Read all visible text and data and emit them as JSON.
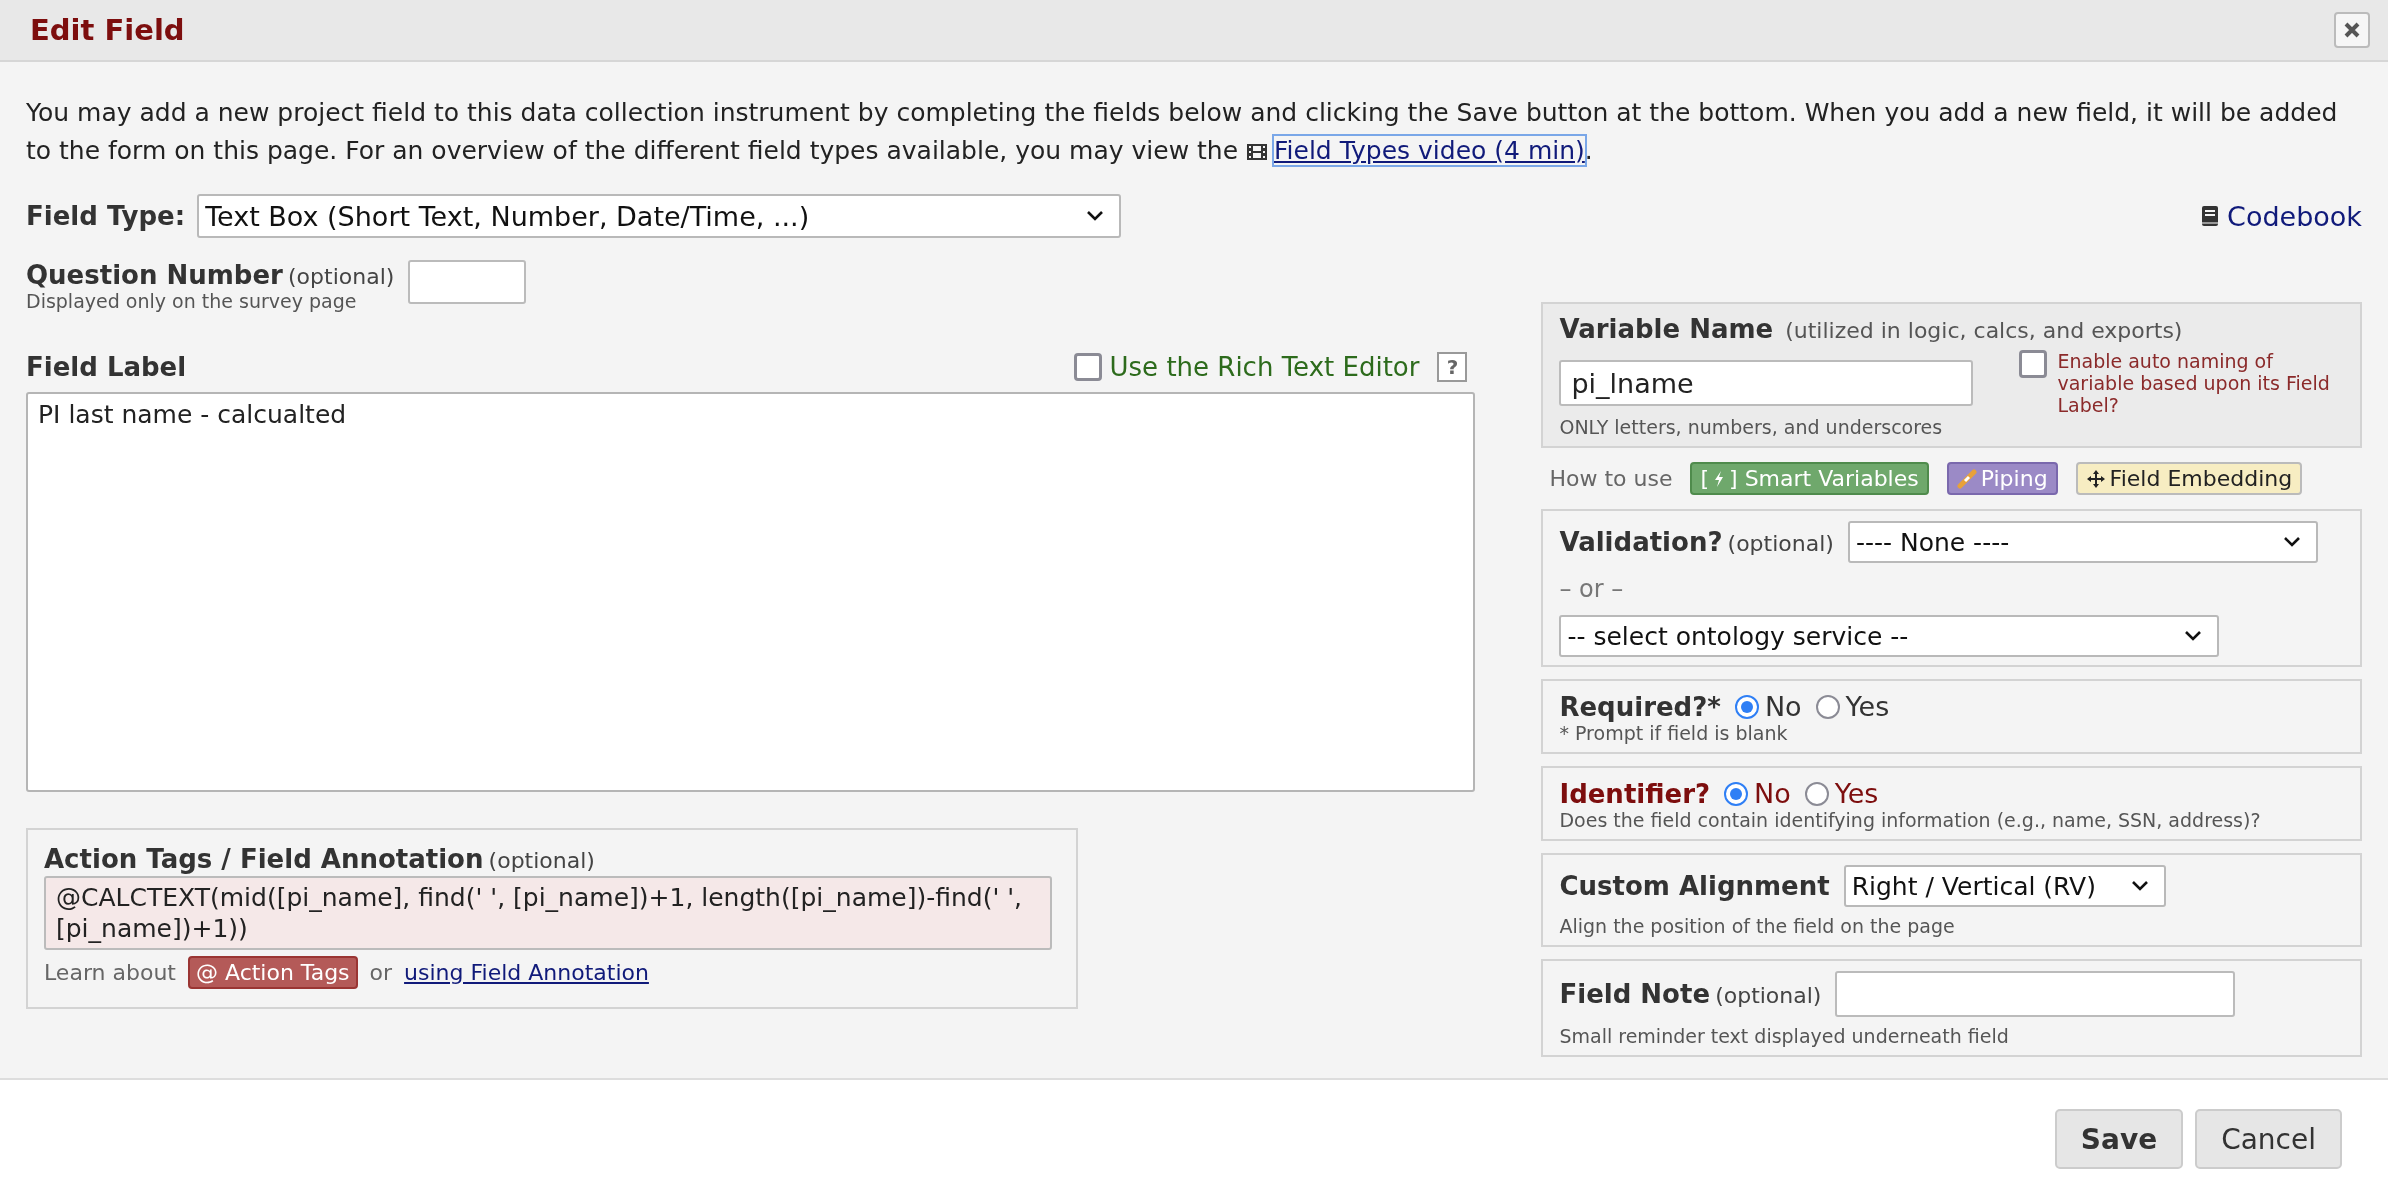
{
  "title": "Edit Field",
  "intro": {
    "text": "You may add a new project field to this data collection instrument by completing the fields below and clicking the Save button at the bottom. When you add a new field, it will be added to the form on this page. For an overview of the different field types available, you may view the",
    "link": "Field Types video (4 min)",
    "after": "."
  },
  "field_type": {
    "label": "Field Type:",
    "value": "Text Box (Short Text, Number, Date/Time, ...)"
  },
  "codebook_link": "Codebook",
  "question_number": {
    "label": "Question Number",
    "optional": "(optional)",
    "hint": "Displayed only on the survey page"
  },
  "field_label": {
    "label": "Field Label",
    "rich_text_editor": {
      "label": "Use the Rich Text Editor",
      "checked": false
    },
    "help": "?",
    "value": "PI last name - calcualted"
  },
  "action_tags": {
    "label": "Action Tags / Field Annotation",
    "optional": "(optional)",
    "value": "@CALCTEXT(mid([pi_name], find(' ', [pi_name])+1, length([pi_name])-find(' ', [pi_name])+1))",
    "learn_about": "Learn about",
    "tags_button": "@ Action Tags",
    "or": "or",
    "annotation_link": "using Field Annotation"
  },
  "variable_name": {
    "label": "Variable Name",
    "note": "(utilized in logic, calcs, and exports)",
    "value": "pi_lname",
    "hint": "ONLY letters, numbers, and underscores",
    "auto_naming": {
      "label": "Enable auto naming of variable based upon its Field Label?",
      "checked": false
    }
  },
  "how_to_use": {
    "label": "How to use",
    "buttons": [
      {
        "kind": "smart",
        "open": "[",
        "close": "]",
        "label": "Smart Variables"
      },
      {
        "kind": "piping",
        "label": "Piping"
      },
      {
        "kind": "embedding",
        "label": "Field Embedding"
      }
    ]
  },
  "validation": {
    "label": "Validation?",
    "optional": "(optional)",
    "value": "---- None ----",
    "or": "– or –",
    "ontology": "-- select ontology service --"
  },
  "required": {
    "label": "Required?*",
    "options": [
      {
        "label": "No",
        "selected": true
      },
      {
        "label": "Yes",
        "selected": false
      }
    ],
    "hint": "* Prompt if field is blank"
  },
  "identifier": {
    "label": "Identifier?",
    "options": [
      {
        "label": "No",
        "selected": true
      },
      {
        "label": "Yes",
        "selected": false
      }
    ],
    "hint": "Does the field contain identifying information (e.g., name, SSN, address)?"
  },
  "alignment": {
    "label": "Custom Alignment",
    "value": "Right / Vertical (RV)",
    "hint": "Align the position of the field on the page"
  },
  "field_note": {
    "label": "Field Note",
    "optional": "(optional)",
    "hint": "Small reminder text displayed underneath field"
  },
  "buttons": [
    {
      "kind": "primary",
      "label": "Save"
    },
    {
      "kind": "secondary",
      "label": "Cancel"
    }
  ]
}
